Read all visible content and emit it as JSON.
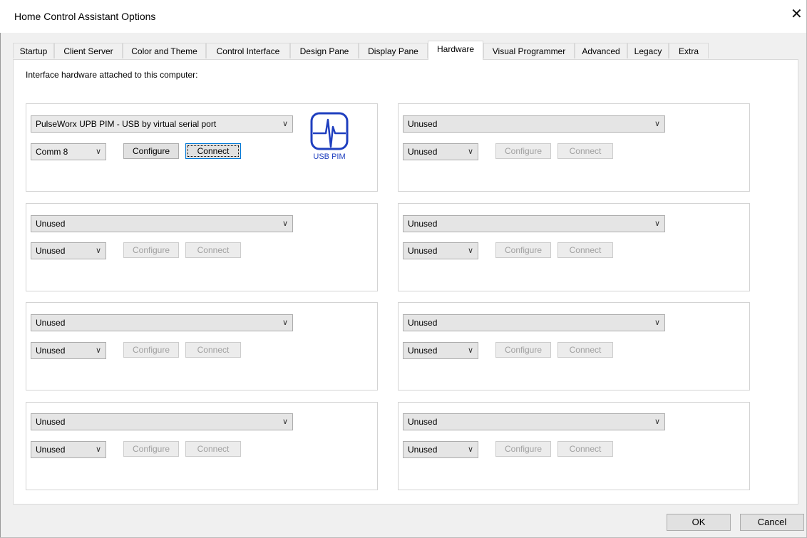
{
  "window": {
    "title": "Home Control Assistant Options",
    "close_glyph": "✕"
  },
  "tabs": [
    {
      "label": "Startup",
      "active": false
    },
    {
      "label": "Client Server",
      "active": false
    },
    {
      "label": "Color and Theme",
      "active": false
    },
    {
      "label": "Control Interface",
      "active": false
    },
    {
      "label": "Design Pane",
      "active": false
    },
    {
      "label": "Display Pane",
      "active": false
    },
    {
      "label": "Hardware",
      "active": true
    },
    {
      "label": "Visual Programmer",
      "active": false
    },
    {
      "label": "Advanced",
      "active": false
    },
    {
      "label": "Legacy",
      "active": false
    },
    {
      "label": "Extra",
      "active": false
    }
  ],
  "hardware": {
    "intro": "Interface hardware attached to this computer:",
    "chevron_glyph": "∨",
    "usb_logo": {
      "icon": "usb-pim-waveform-icon",
      "label": "USB PIM",
      "color": "#1f3fbf"
    },
    "slots": [
      {
        "interface": "PulseWorx UPB PIM - USB by virtual serial port",
        "port": "Comm 8",
        "configure": "Configure",
        "connect": "Connect",
        "enabled": true
      },
      {
        "interface": "Unused",
        "port": "Unused",
        "configure": "Configure",
        "connect": "Connect",
        "enabled": false
      },
      {
        "interface": "Unused",
        "port": "Unused",
        "configure": "Configure",
        "connect": "Connect",
        "enabled": false
      },
      {
        "interface": "Unused",
        "port": "Unused",
        "configure": "Configure",
        "connect": "Connect",
        "enabled": false
      },
      {
        "interface": "Unused",
        "port": "Unused",
        "configure": "Configure",
        "connect": "Connect",
        "enabled": false
      },
      {
        "interface": "Unused",
        "port": "Unused",
        "configure": "Configure",
        "connect": "Connect",
        "enabled": false
      },
      {
        "interface": "Unused",
        "port": "Unused",
        "configure": "Configure",
        "connect": "Connect",
        "enabled": false
      },
      {
        "interface": "Unused",
        "port": "Unused",
        "configure": "Configure",
        "connect": "Connect",
        "enabled": false
      }
    ]
  },
  "footer": {
    "ok_label": "OK",
    "cancel_label": "Cancel"
  }
}
